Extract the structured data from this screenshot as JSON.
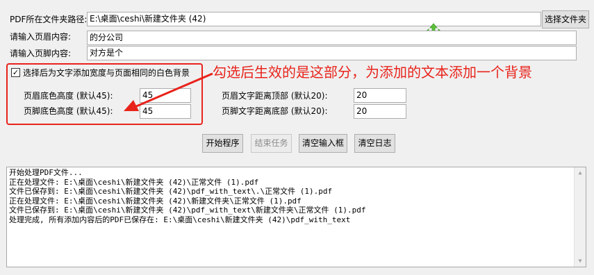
{
  "form": {
    "folder_label": "PDF所在文件夹路径:",
    "folder_value": "E:\\桌面\\ceshi\\新建文件夹 (42)",
    "choose_folder_button": "选择文件夹",
    "header_label": "请输入页眉内容:",
    "header_value": "的分公司",
    "footer_label": "请输入页脚内容:",
    "footer_value": "对方是个"
  },
  "background_option": {
    "checkbox_label": "选择后为文字添加宽度与页面相同的白色背景",
    "checked": true,
    "check_glyph": "✓",
    "header_height_label": "页眉底色高度 (默认45):",
    "header_height_value": "45",
    "footer_height_label": "页脚底色高度 (默认45):",
    "footer_height_value": "45"
  },
  "distance": {
    "header_top_label": "页眉文字距离顶部 (默认20):",
    "header_top_value": "20",
    "footer_bottom_label": "页脚文字距离底部 (默认20):",
    "footer_bottom_value": "20"
  },
  "annotation": {
    "text": "勾选后生效的是这部分，为添加的文本添加一个背景",
    "color": "#e8231b"
  },
  "buttons": {
    "start": "开始程序",
    "stop": "结束任务",
    "clear_input": "清空输入框",
    "clear_log": "清空日志"
  },
  "log": {
    "lines": [
      "开始处理PDF文件...",
      "正在处理文件: E:\\桌面\\ceshi\\新建文件夹 (42)\\正常文件 (1).pdf",
      "文件已保存到: E:\\桌面\\ceshi\\新建文件夹 (42)\\pdf_with_text\\.\\正常文件 (1).pdf",
      "正在处理文件: E:\\桌面\\ceshi\\新建文件夹 (42)\\新建文件夹\\正常文件 (1).pdf",
      "文件已保存到: E:\\桌面\\ceshi\\新建文件夹 (42)\\pdf_with_text\\新建文件夹\\正常文件 (1).pdf",
      "处理完成, 所有添加内容后的PDF已保存在: E:\\桌面\\ceshi\\新建文件夹 (42)\\pdf_with_text"
    ]
  },
  "icons": {
    "move_cursor": "move-cursor-icon",
    "move_cursor_color": "#5dc33a"
  }
}
